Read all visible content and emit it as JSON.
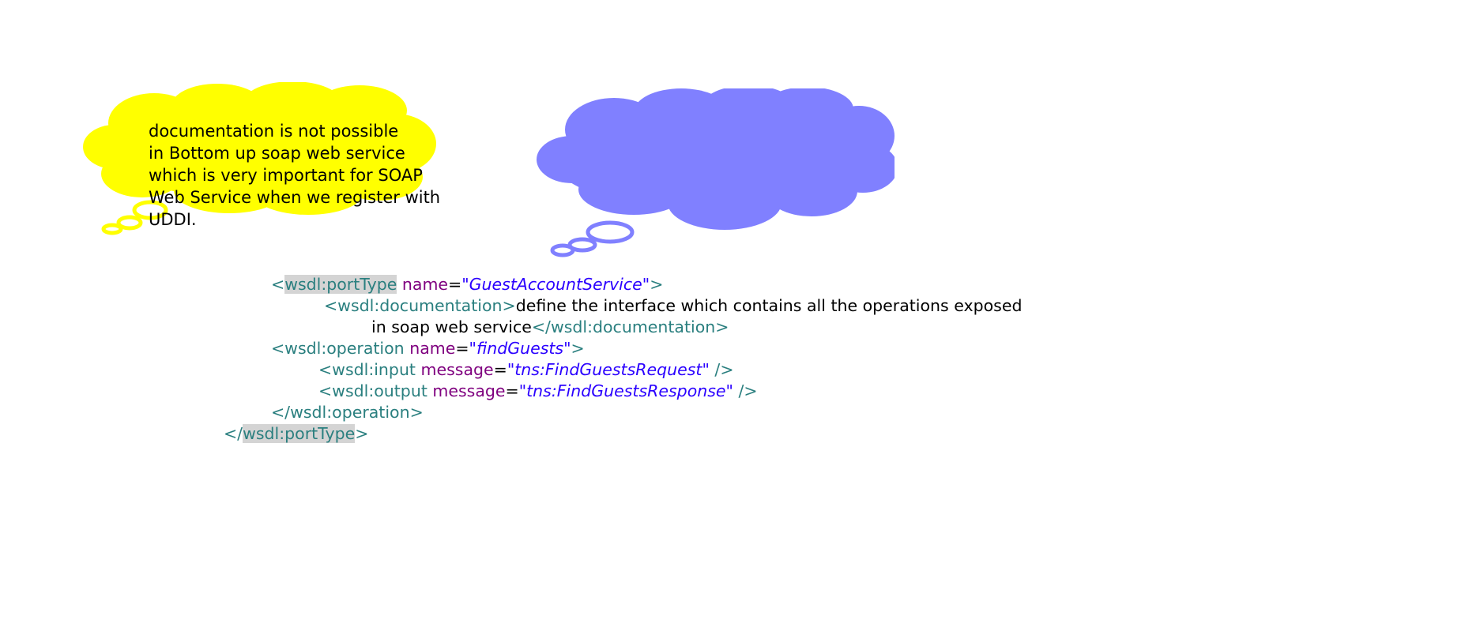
{
  "callout": {
    "lines": [
      "documentation is not possible",
      "in Bottom up soap web service",
      "which is very important for SOAP",
      "Web Service when we register with",
      "UDDI."
    ]
  },
  "colors": {
    "yellow_bubble": "#ffff00",
    "blue_bubble": "#8080ff",
    "tag": "#2a7f7f",
    "attribute": "#7f007f",
    "value": "#2a00ff",
    "highlight": "#d4d4d4"
  },
  "code": {
    "l1": {
      "lt": "<",
      "tag": "wsdl:portType",
      "attr": "name",
      "eq": "=",
      "val": "\"GuestAccountService\"",
      "gt": ">"
    },
    "l2": {
      "open": "<wsdl:documentation>",
      "text": "define the interface which contains all the operations exposed"
    },
    "l3": {
      "text": "in soap web service",
      "close": "</wsdl:documentation>"
    },
    "l4": {
      "tag": "<wsdl:operation",
      "attr": "name",
      "eq": "=",
      "val": "\"findGuests\"",
      "gt": ">"
    },
    "l5": {
      "tag": "<wsdl:input",
      "attr": "message",
      "eq": "=",
      "val": "\"tns:FindGuestsRequest\"",
      "end": " />"
    },
    "l6": {
      "tag": "<wsdl:output",
      "attr": "message",
      "eq": "=",
      "val": "\"tns:FindGuestsResponse\"",
      "end": " />"
    },
    "l7": {
      "close": "</wsdl:operation>"
    },
    "l8": {
      "lt": "</",
      "tag": "wsdl:portType",
      "gt": ">"
    }
  }
}
